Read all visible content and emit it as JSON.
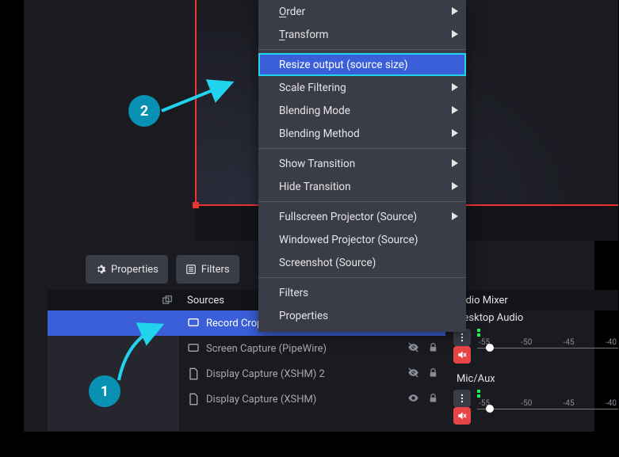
{
  "toolbar": {
    "properties_label": "Properties",
    "filters_label": "Filters"
  },
  "panels": {
    "sources_title": "Sources",
    "mixer_title": "Audio Mixer"
  },
  "sources": [
    {
      "label": "Record Cropped Area",
      "type": "crop",
      "selected": true,
      "eye_hidden": true,
      "locked": false
    },
    {
      "label": "Screen Capture (PipeWire)",
      "type": "screen",
      "selected": false,
      "eye_hidden": true,
      "locked": false
    },
    {
      "label": "Display Capture (XSHM) 2",
      "type": "display",
      "selected": false,
      "eye_hidden": true,
      "locked": false
    },
    {
      "label": "Display Capture (XSHM)",
      "type": "display",
      "selected": false,
      "eye_hidden": false,
      "locked": false
    }
  ],
  "context_menu": [
    {
      "label": "Order",
      "underline_first": true,
      "has_submenu": true
    },
    {
      "label": "Transform",
      "underline_first": true,
      "has_submenu": true
    },
    {
      "sep": true
    },
    {
      "label": "Resize output (source size)",
      "selected": true
    },
    {
      "label": "Scale Filtering",
      "has_submenu": true
    },
    {
      "label": "Blending Mode",
      "has_submenu": true
    },
    {
      "label": "Blending Method",
      "has_submenu": true
    },
    {
      "sep": true
    },
    {
      "label": "Show Transition",
      "has_submenu": true
    },
    {
      "label": "Hide Transition",
      "has_submenu": true
    },
    {
      "sep": true
    },
    {
      "label": "Fullscreen Projector (Source)",
      "has_submenu": true
    },
    {
      "label": "Windowed Projector (Source)"
    },
    {
      "label": "Screenshot (Source)"
    },
    {
      "sep": true
    },
    {
      "label": "Filters"
    },
    {
      "label": "Properties"
    }
  ],
  "mixer": {
    "channels": [
      {
        "name": "Desktop Audio",
        "ticks": [
          "-55",
          "-50",
          "-45",
          "-40"
        ],
        "knob_pct": 6
      },
      {
        "name": "Mic/Aux",
        "ticks": [
          "-55",
          "-50",
          "-45",
          "-40"
        ],
        "knob_pct": 6
      }
    ]
  },
  "callouts": {
    "one": "1",
    "two": "2"
  }
}
